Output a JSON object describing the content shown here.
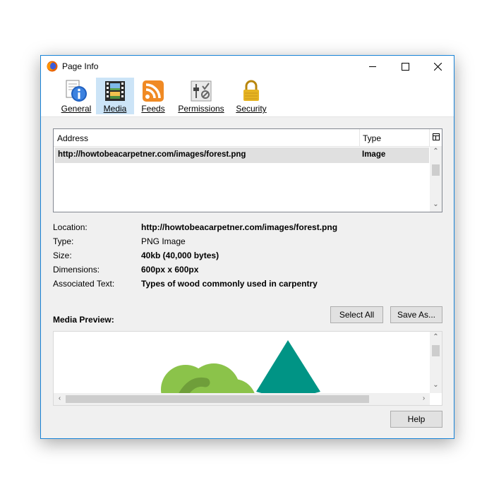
{
  "window": {
    "title": "Page Info"
  },
  "tabs": [
    {
      "label": "General",
      "icon": "info-icon"
    },
    {
      "label": "Media",
      "icon": "media-icon",
      "active": true
    },
    {
      "label": "Feeds",
      "icon": "rss-icon"
    },
    {
      "label": "Permissions",
      "icon": "permissions-icon"
    },
    {
      "label": "Security",
      "icon": "lock-icon"
    }
  ],
  "media_list": {
    "columns": [
      "Address",
      "Type"
    ],
    "rows": [
      {
        "address": "http://howtobeacarpetner.com/images/forest.png",
        "type": "Image"
      }
    ]
  },
  "details": {
    "location": {
      "label": "Location:",
      "value": "http://howtobeacarpetner.com/images/forest.png"
    },
    "type": {
      "label": "Type:",
      "value": "PNG Image"
    },
    "size": {
      "label": "Size:",
      "value": "40kb (40,000 bytes)"
    },
    "dimensions": {
      "label": "Dimensions:",
      "value": "600px x 600px"
    },
    "associated_text": {
      "label": "Associated Text:",
      "value": "Types of wood commonly used in carpentry"
    }
  },
  "preview": {
    "label": "Media Preview:"
  },
  "buttons": {
    "select_all": "Select All",
    "save_as": "Save As...",
    "help": "Help"
  },
  "colors": {
    "accent": "#1883d7",
    "tree_green": "#8bc34a",
    "tree_dark": "#6f9e3a",
    "teal": "#009485",
    "active_tab": "#cce4f7"
  }
}
